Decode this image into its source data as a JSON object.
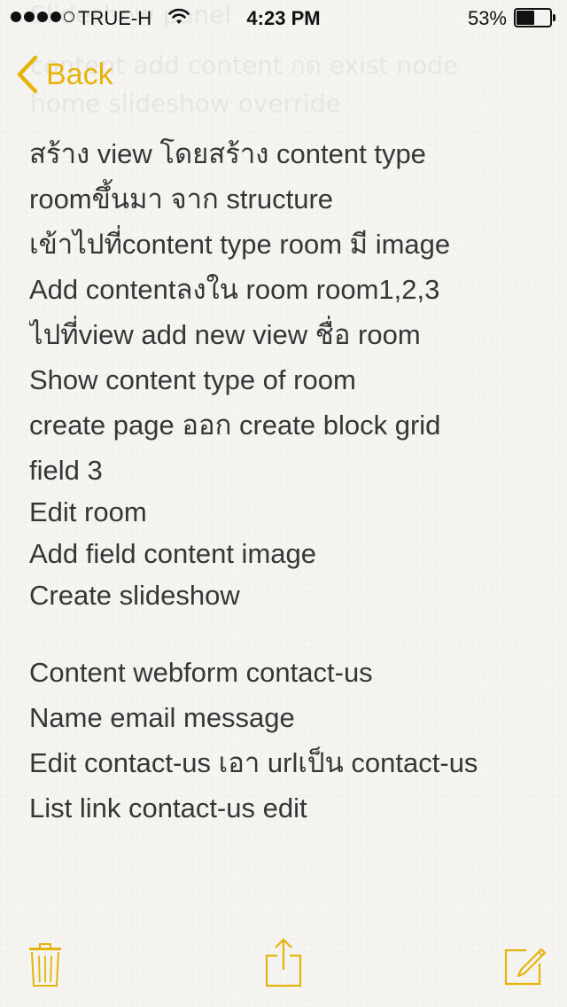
{
  "status_bar": {
    "carrier": "TRUE-H",
    "time": "4:23 PM",
    "battery_percent": "53%",
    "battery_level": 0.53,
    "signal_bars": 4,
    "signal_total": 5
  },
  "ghost_text": {
    "line1": "Slideshow panel",
    "line2": "content add content กด exist node",
    "line3": "home slideshow override"
  },
  "nav": {
    "back_label": "Back"
  },
  "note": {
    "lines": [
      "สร้าง view โดยสร้าง content type",
      "roomขึ้นมา จาก structure",
      "เข้าไปที่content type room มี image",
      "Add contentลงใน room room1,2,3",
      "ไปที่view add new view ชื่อ room",
      "Show content type of room",
      "create page ออก create block grid",
      "field 3",
      "Edit room",
      "Add field content image",
      "Create slideshow",
      "",
      "Content webform contact-us",
      "Name email message",
      "Edit contact-us เอา urlเป็น contact-us",
      "List link contact-us edit"
    ]
  },
  "toolbar": {
    "trash_icon": "trash-icon",
    "share_icon": "share-icon",
    "compose_icon": "compose-icon"
  },
  "colors": {
    "accent": "#e5b40b",
    "background": "#f5f4f1",
    "text": "#363636"
  }
}
